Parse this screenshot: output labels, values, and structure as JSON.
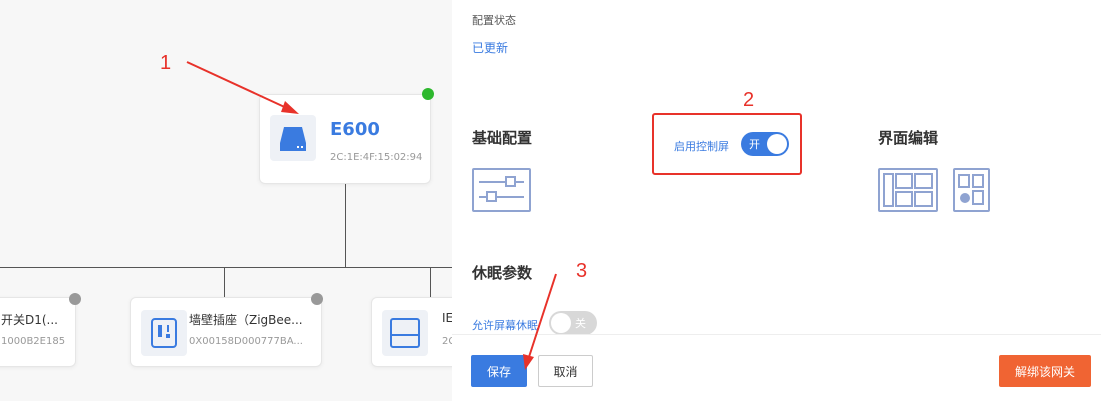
{
  "topology": {
    "gateway": {
      "name": "E600",
      "mac": "2C:1E:4F:15:02:94",
      "status_color": "#2eb82e"
    },
    "children": [
      {
        "name": "开关D1(...",
        "id": "1000B2E185",
        "status_color": "#999999"
      },
      {
        "name": "墙壁插座（ZigBee...",
        "id": "0X00158D000777BA...",
        "status_color": "#999999"
      },
      {
        "name": "IE",
        "id": "2C",
        "status_color": "#999999"
      }
    ]
  },
  "annotations": {
    "one": "1",
    "two": "2",
    "three": "3"
  },
  "panel": {
    "config_status_label": "配置状态",
    "config_status_value": "已更新",
    "basic_config_title": "基础配置",
    "control_screen_label": "启用控制屏",
    "control_screen_toggle": "开",
    "ui_edit_title": "界面编辑",
    "sleep_params_title": "休眠参数",
    "allow_sleep_label": "允许屏幕休眠",
    "allow_sleep_toggle": "关"
  },
  "footer": {
    "save": "保存",
    "cancel": "取消",
    "unbind": "解绑该网关"
  },
  "colors": {
    "accent": "#3a7be0",
    "danger": "#f06433",
    "annotation": "#e8322a",
    "online": "#2eb82e",
    "offline": "#999999"
  }
}
